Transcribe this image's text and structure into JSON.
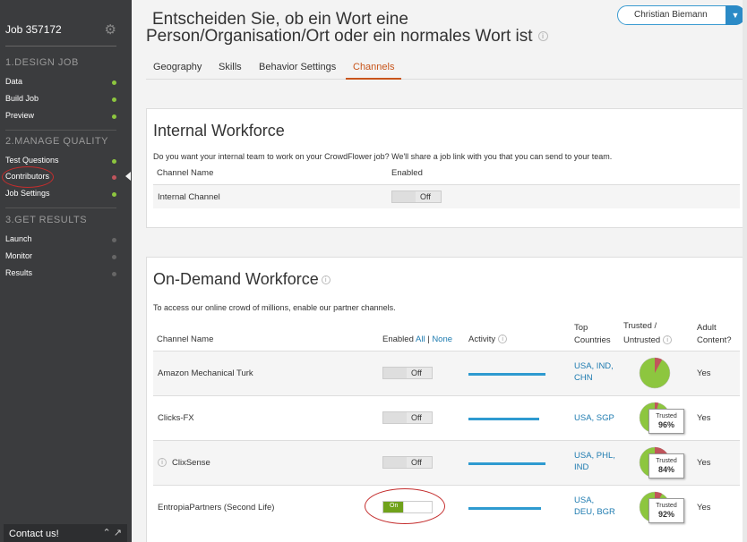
{
  "sidebar": {
    "job_title": "Job 357172",
    "sections": [
      {
        "title": "1.DESIGN JOB",
        "items": [
          {
            "label": "Data",
            "status": "green"
          },
          {
            "label": "Build Job",
            "status": "green"
          },
          {
            "label": "Preview",
            "status": "green"
          }
        ]
      },
      {
        "title": "2.MANAGE QUALITY",
        "items": [
          {
            "label": "Test Questions",
            "status": "green"
          },
          {
            "label": "Contributors",
            "status": "red"
          },
          {
            "label": "Job Settings",
            "status": "green"
          }
        ]
      },
      {
        "title": "3.GET RESULTS",
        "items": [
          {
            "label": "Launch",
            "status": "gray"
          },
          {
            "label": "Monitor",
            "status": "gray"
          },
          {
            "label": "Results",
            "status": "gray"
          }
        ]
      }
    ],
    "contact": "Contact us!"
  },
  "header": {
    "title_line1": "Entscheiden Sie, ob ein Wort eine",
    "title_line2": "Person/Organisation/Ort oder ein normales Wort ist",
    "user": "Christian Biemann"
  },
  "tabs": [
    "Geography",
    "Skills",
    "Behavior Settings",
    "Channels"
  ],
  "active_tab": "Channels",
  "internal": {
    "heading": "Internal Workforce",
    "description": "Do you want your internal team to work on your CrowdFlower job? We'll share a job link with you that you can send to your team.",
    "col_channel": "Channel Name",
    "col_enabled": "Enabled",
    "row": {
      "name": "Internal Channel",
      "toggle": "Off"
    }
  },
  "ondemand": {
    "heading": "On-Demand Workforce",
    "description": "To access our online crowd of millions, enable our partner channels.",
    "col_channel": "Channel Name",
    "col_enabled": "Enabled",
    "all": "All",
    "separator": "|",
    "none": "None",
    "col_activity": "Activity",
    "col_top": "Top",
    "col_countries": "Countries",
    "col_trusted": "Trusted /",
    "col_untrusted": "Untrusted",
    "col_adult": "Adult",
    "col_content": "Content?",
    "trusted_label": "Trusted",
    "rows": [
      {
        "name": "Amazon Mechanical Turk",
        "toggle": "Off",
        "enabled": false,
        "activity": 0.95,
        "countries": [
          "USA, IND,",
          "CHN"
        ],
        "trusted_pct": "",
        "trusted_frac": 0.92,
        "adult": "Yes"
      },
      {
        "name": "Clicks-FX",
        "toggle": "Off",
        "enabled": false,
        "activity": 0.88,
        "countries": [
          "USA, SGP"
        ],
        "trusted_pct": "96%",
        "trusted_frac": 0.96,
        "adult": "Yes"
      },
      {
        "name": "ClixSense",
        "toggle": "Off",
        "enabled": false,
        "activity": 0.95,
        "countries": [
          "USA, PHL,",
          "IND"
        ],
        "trusted_pct": "84%",
        "trusted_frac": 0.84,
        "adult": "Yes"
      },
      {
        "name": "EntropiaPartners (Second Life)",
        "toggle": "On",
        "enabled": true,
        "activity": 0.9,
        "countries": [
          "USA,",
          "DEU, BGR"
        ],
        "trusted_pct": "92%",
        "trusted_frac": 0.92,
        "adult": "Yes"
      }
    ]
  },
  "colors": {
    "sidebar_bg": "#3b3c3e",
    "accent_tab": "#c8551b",
    "link": "#1e7bb0",
    "activity_bar": "#2e9ad0",
    "pie_trusted": "#8dc63f",
    "pie_untrusted": "#c0555c",
    "toggle_on": "#70a21b",
    "annotation_red": "#c42d2d"
  }
}
